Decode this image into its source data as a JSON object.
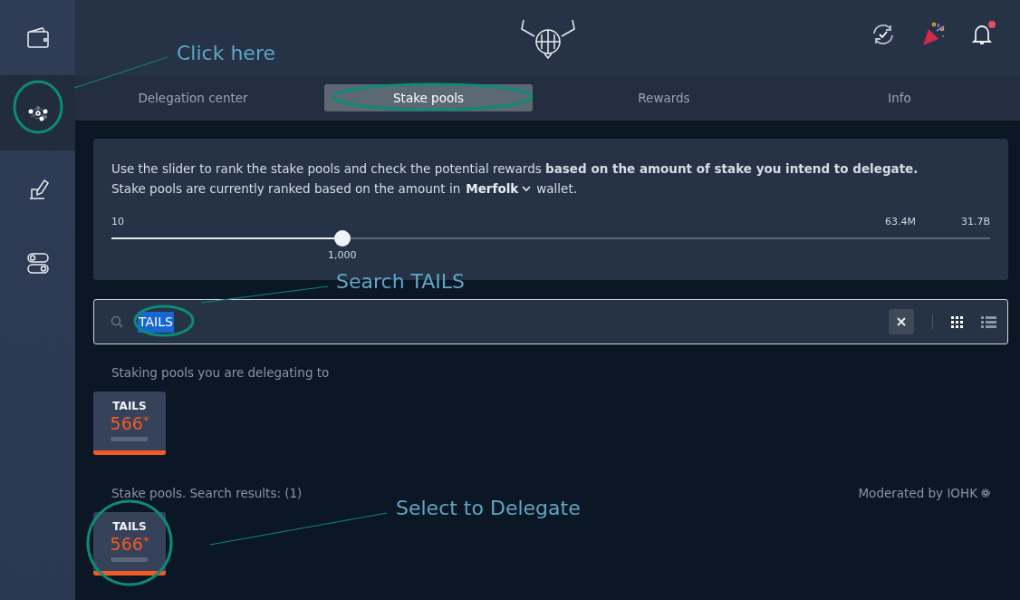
{
  "sidebar": {
    "items": [
      {
        "kind": "wallet",
        "selected": false
      },
      {
        "kind": "network",
        "selected": true
      },
      {
        "kind": "voting",
        "selected": false
      },
      {
        "kind": "settings",
        "selected": false
      }
    ]
  },
  "header": {
    "notifications_unread": true
  },
  "tabs": [
    {
      "label": "Delegation center",
      "selected": false
    },
    {
      "label": "Stake pools",
      "selected": true
    },
    {
      "label": "Rewards",
      "selected": false
    },
    {
      "label": "Info",
      "selected": false
    }
  ],
  "ranking_panel": {
    "description": "Use the slider to rank the stake pools and check the potential rewards **based on the amount of stake you intend to delegate.**",
    "ranking_text": "Stake pools are currently ranked based on the amount in",
    "wallet_name": "Merfolk",
    "ranking_suffix": "wallet.",
    "slider": {
      "min_label": "10",
      "mid_label": "63.4M",
      "max_label": "31.7B",
      "value_label": "1,000",
      "level": 0.263
    }
  },
  "search": {
    "value": "TAILS",
    "value_selected": true,
    "views": [
      {
        "kind": "grid",
        "selected": true
      },
      {
        "kind": "list",
        "selected": false
      }
    ]
  },
  "delegating_section": {
    "title": "Staking pools you are delegating to",
    "pools": [
      {
        "ticker": "TAILS",
        "rank": "566",
        "mark": "*",
        "level": 0.03,
        "color": "#f25a24"
      }
    ]
  },
  "results_section": {
    "title": "Stake pools. Search results: (1)",
    "moderated": "Moderated by IOHK",
    "pools": [
      {
        "ticker": "TAILS",
        "rank": "566",
        "mark": "*",
        "level": 0.03,
        "color": "#f25a24"
      }
    ]
  },
  "annotations": [
    {
      "text": "Click here"
    },
    {
      "text": "Search TAILS"
    },
    {
      "text": "Select to Delegate"
    }
  ]
}
